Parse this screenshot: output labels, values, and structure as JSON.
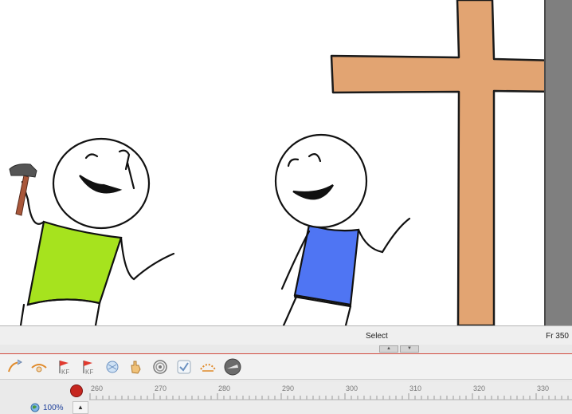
{
  "status": {
    "tool": "Select",
    "frame": "Fr 350"
  },
  "toolbar": {
    "buttons": [
      {
        "name": "curve-left-tool-button",
        "icon": "curve-arrow-icon"
      },
      {
        "name": "curve-orange-tool-button",
        "icon": "curve-orange-icon"
      },
      {
        "name": "keyframe-add-button",
        "icon": "keyframe-flag-icon",
        "badge": "KF"
      },
      {
        "name": "keyframe-remove-button",
        "icon": "keyframe-flag-icon",
        "badge": "KF"
      },
      {
        "name": "onion-skin-button",
        "icon": "onion-skin-icon"
      },
      {
        "name": "move-hand-button",
        "icon": "hand-icon"
      },
      {
        "name": "target-button",
        "icon": "target-icon"
      },
      {
        "name": "check-button",
        "icon": "checkmark-icon"
      },
      {
        "name": "curve-dotted-button",
        "icon": "dotted-curve-icon"
      },
      {
        "name": "render-button",
        "icon": "render-sphere-icon"
      }
    ]
  },
  "timeline": {
    "ruler_labels": [
      "260",
      "270",
      "280",
      "290",
      "300",
      "310",
      "320",
      "330"
    ],
    "zoom": "100%",
    "zoom_up_label": "▲"
  },
  "colors": {
    "cross": "#e2a472",
    "shirt_green": "#a6e31e",
    "shirt_blue": "#4f75f3",
    "hammer_handle": "#a9573a",
    "playhead": "#c6261f"
  }
}
